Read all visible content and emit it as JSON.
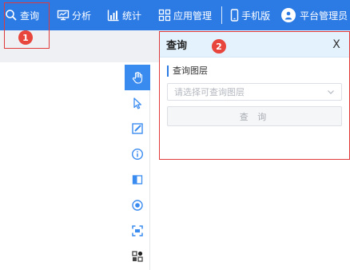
{
  "nav": {
    "query_label": "查询",
    "analysis_label": "分析",
    "stats_label": "统计",
    "app_manage_label": "应用管理",
    "mobile_label": "手机版",
    "user_label": "平台管理员"
  },
  "annotations": {
    "one": "1",
    "two": "2"
  },
  "panel": {
    "title": "查询",
    "close_label": "X",
    "layer_label": "查询图层",
    "layer_placeholder": "请选择可查询图层",
    "query_button": "查 询"
  },
  "tools": [
    "hand-icon",
    "cursor-icon",
    "edit-icon",
    "info-icon",
    "compare-icon",
    "locate-icon",
    "fullscreen-icon",
    "layers-icon"
  ],
  "colors": {
    "topbar": "#2c7be5",
    "active_tool": "#3a8bf0",
    "annotation": "#e03a3a",
    "panel_header": "#e3f2fd"
  }
}
